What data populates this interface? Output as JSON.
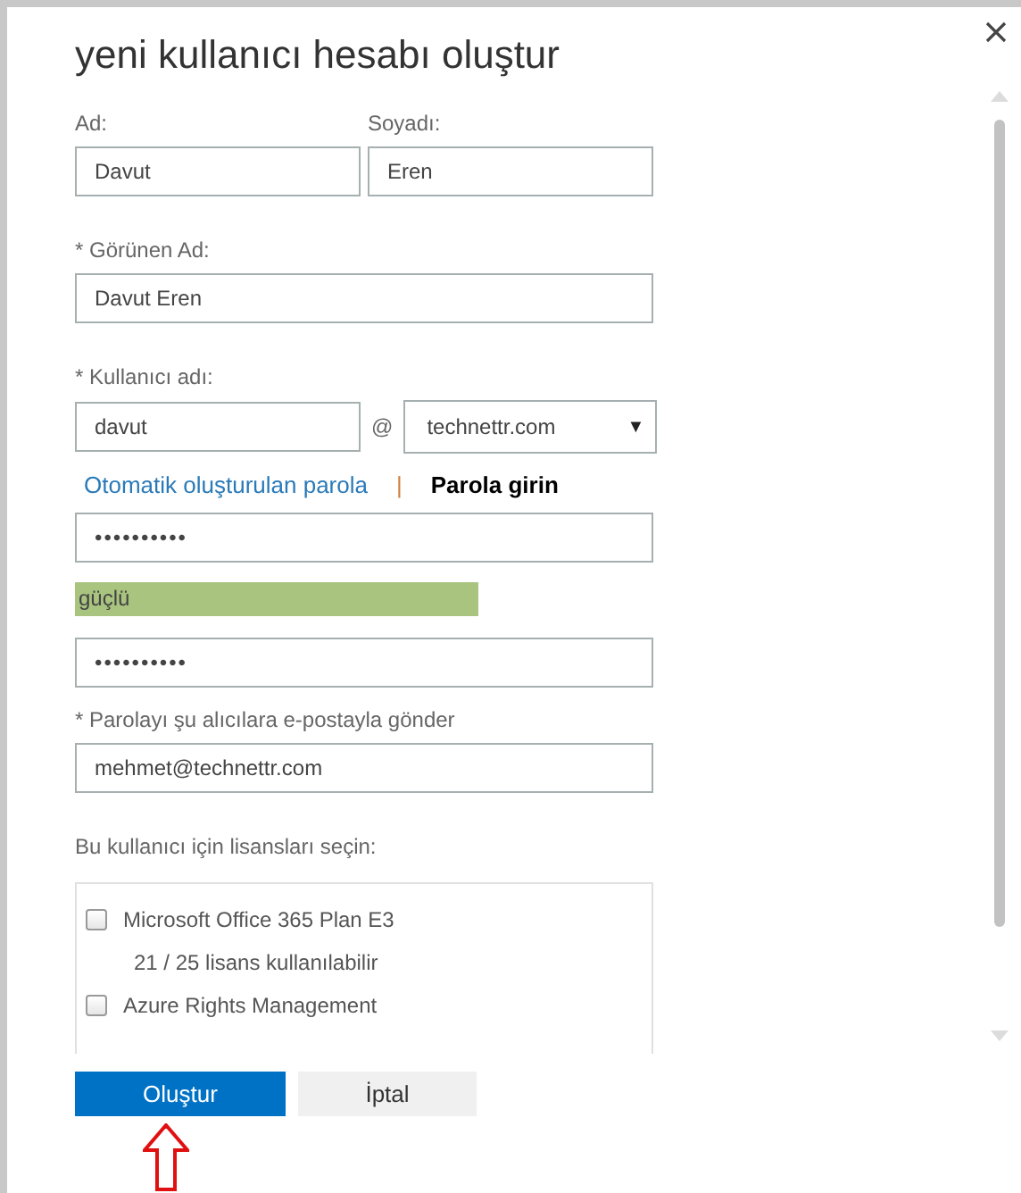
{
  "dialog": {
    "title": "yeni kullanıcı hesabı oluştur",
    "first_name": {
      "label": "Ad:",
      "value": "Davut"
    },
    "last_name": {
      "label": "Soyadı:",
      "value": "Eren"
    },
    "display_name": {
      "label": "* Görünen Ad:",
      "value": "Davut Eren"
    },
    "username": {
      "label": "* Kullanıcı adı:",
      "value": "davut",
      "at": "@",
      "domain": "technettr.com",
      "caret": "▼"
    },
    "password_modes": [
      {
        "label": "Otomatik oluşturulan parola",
        "selected": false
      },
      {
        "label": "Parola girin",
        "selected": true
      }
    ],
    "password_modes_separator": "|",
    "password": {
      "value": "••••••••••"
    },
    "strength": {
      "label": "güçlü"
    },
    "confirm_password": {
      "value": "••••••••••"
    },
    "send_to": {
      "label": "* Parolayı şu alıcılara e-postayla gönder",
      "value": "mehmet@technettr.com"
    },
    "licenses_label": "Bu kullanıcı için lisansları seçin:",
    "licenses": [
      {
        "name": "Microsoft Office 365 Plan E3",
        "availability": "21 / 25 lisans kullanılabilir",
        "checked": false
      },
      {
        "name": "Azure Rights Management",
        "checked": false
      }
    ],
    "buttons": [
      {
        "label": "Oluştur",
        "kind": "primary"
      },
      {
        "label": "İptal",
        "kind": "secondary"
      }
    ]
  }
}
